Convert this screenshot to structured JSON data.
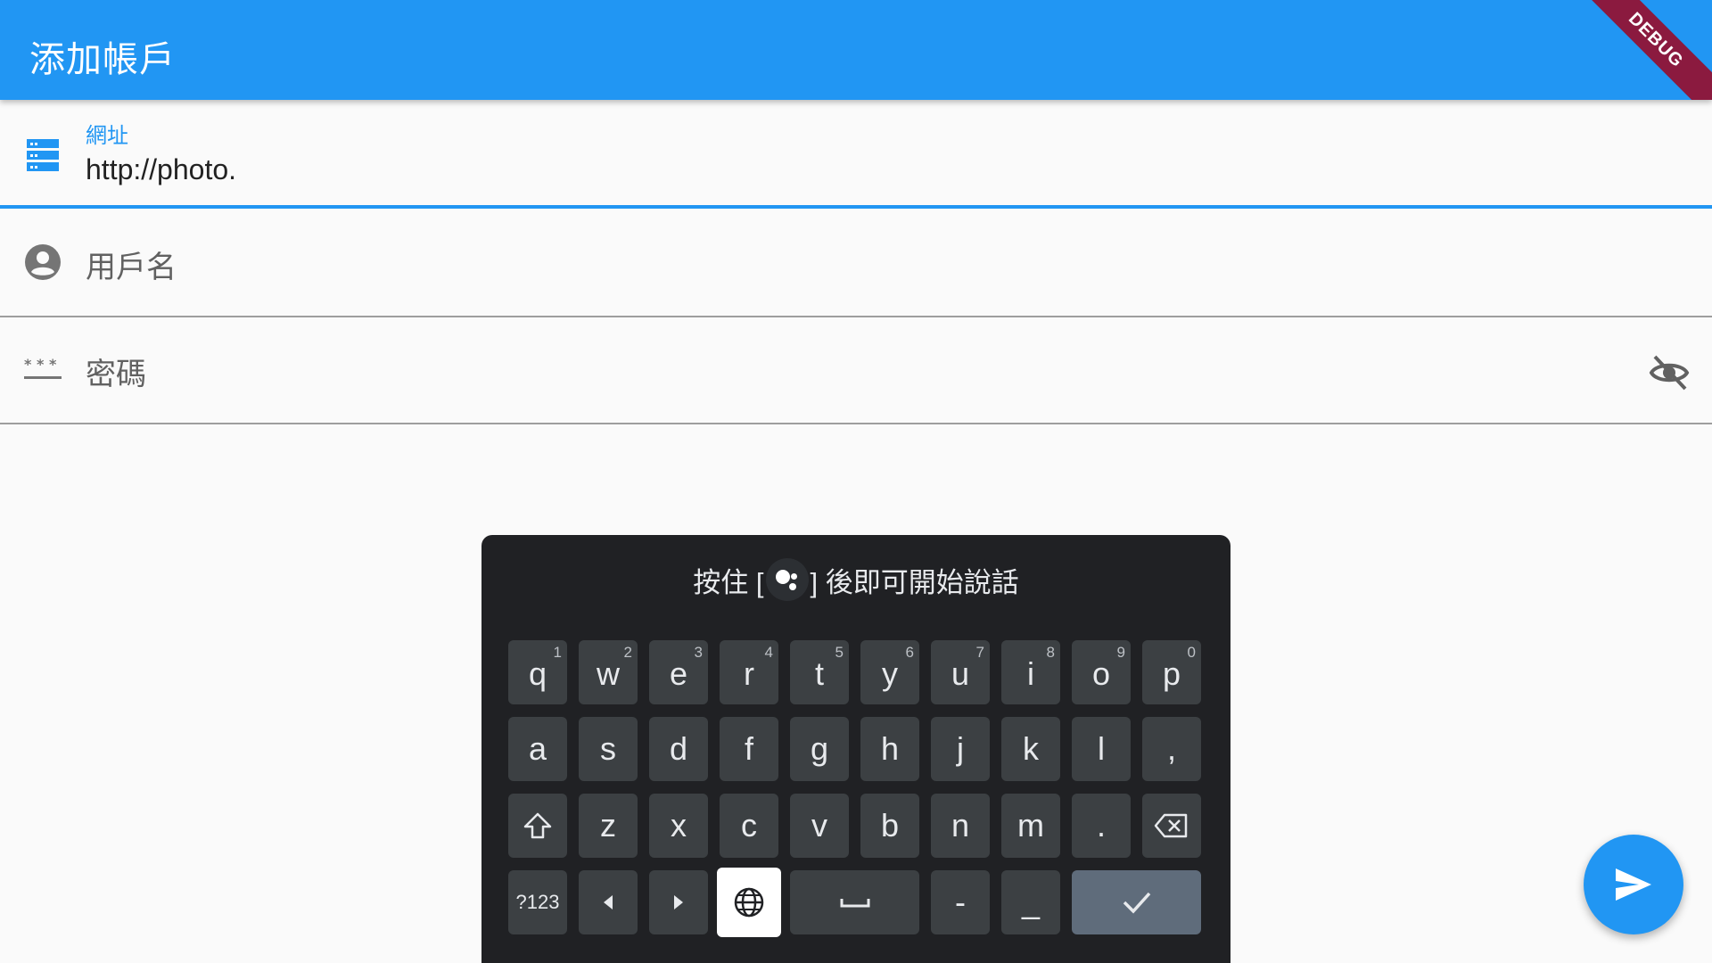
{
  "appbar": {
    "title": "添加帳戶",
    "debug_banner": "DEBUG"
  },
  "fields": {
    "url": {
      "label": "網址",
      "value": "http://photo.",
      "icon": "server-icon"
    },
    "username": {
      "placeholder": "用戶名",
      "icon": "account-circle-icon"
    },
    "password": {
      "placeholder": "密碼",
      "icon": "password-icon",
      "toggle_icon": "visibility-off-icon"
    }
  },
  "keyboard": {
    "voice_hint_before": "按住 [",
    "voice_hint_after": "] 後即可開始說話",
    "row1": [
      {
        "char": "q",
        "num": "1"
      },
      {
        "char": "w",
        "num": "2"
      },
      {
        "char": "e",
        "num": "3"
      },
      {
        "char": "r",
        "num": "4"
      },
      {
        "char": "t",
        "num": "5"
      },
      {
        "char": "y",
        "num": "6"
      },
      {
        "char": "u",
        "num": "7"
      },
      {
        "char": "i",
        "num": "8"
      },
      {
        "char": "o",
        "num": "9"
      },
      {
        "char": "p",
        "num": "0"
      }
    ],
    "row2": [
      "a",
      "s",
      "d",
      "f",
      "g",
      "h",
      "j",
      "k",
      "l",
      ","
    ],
    "row3": [
      "z",
      "x",
      "c",
      "v",
      "b",
      "n",
      "m",
      "."
    ],
    "symbols_key": "?123",
    "dash_key": "-",
    "underscore_key": "_"
  },
  "fab": {
    "icon": "send-icon"
  },
  "colors": {
    "primary": "#2196f3",
    "keyboard_bg": "#202124",
    "key_bg": "#3c4043",
    "enter_bg": "#5f6c7b"
  }
}
